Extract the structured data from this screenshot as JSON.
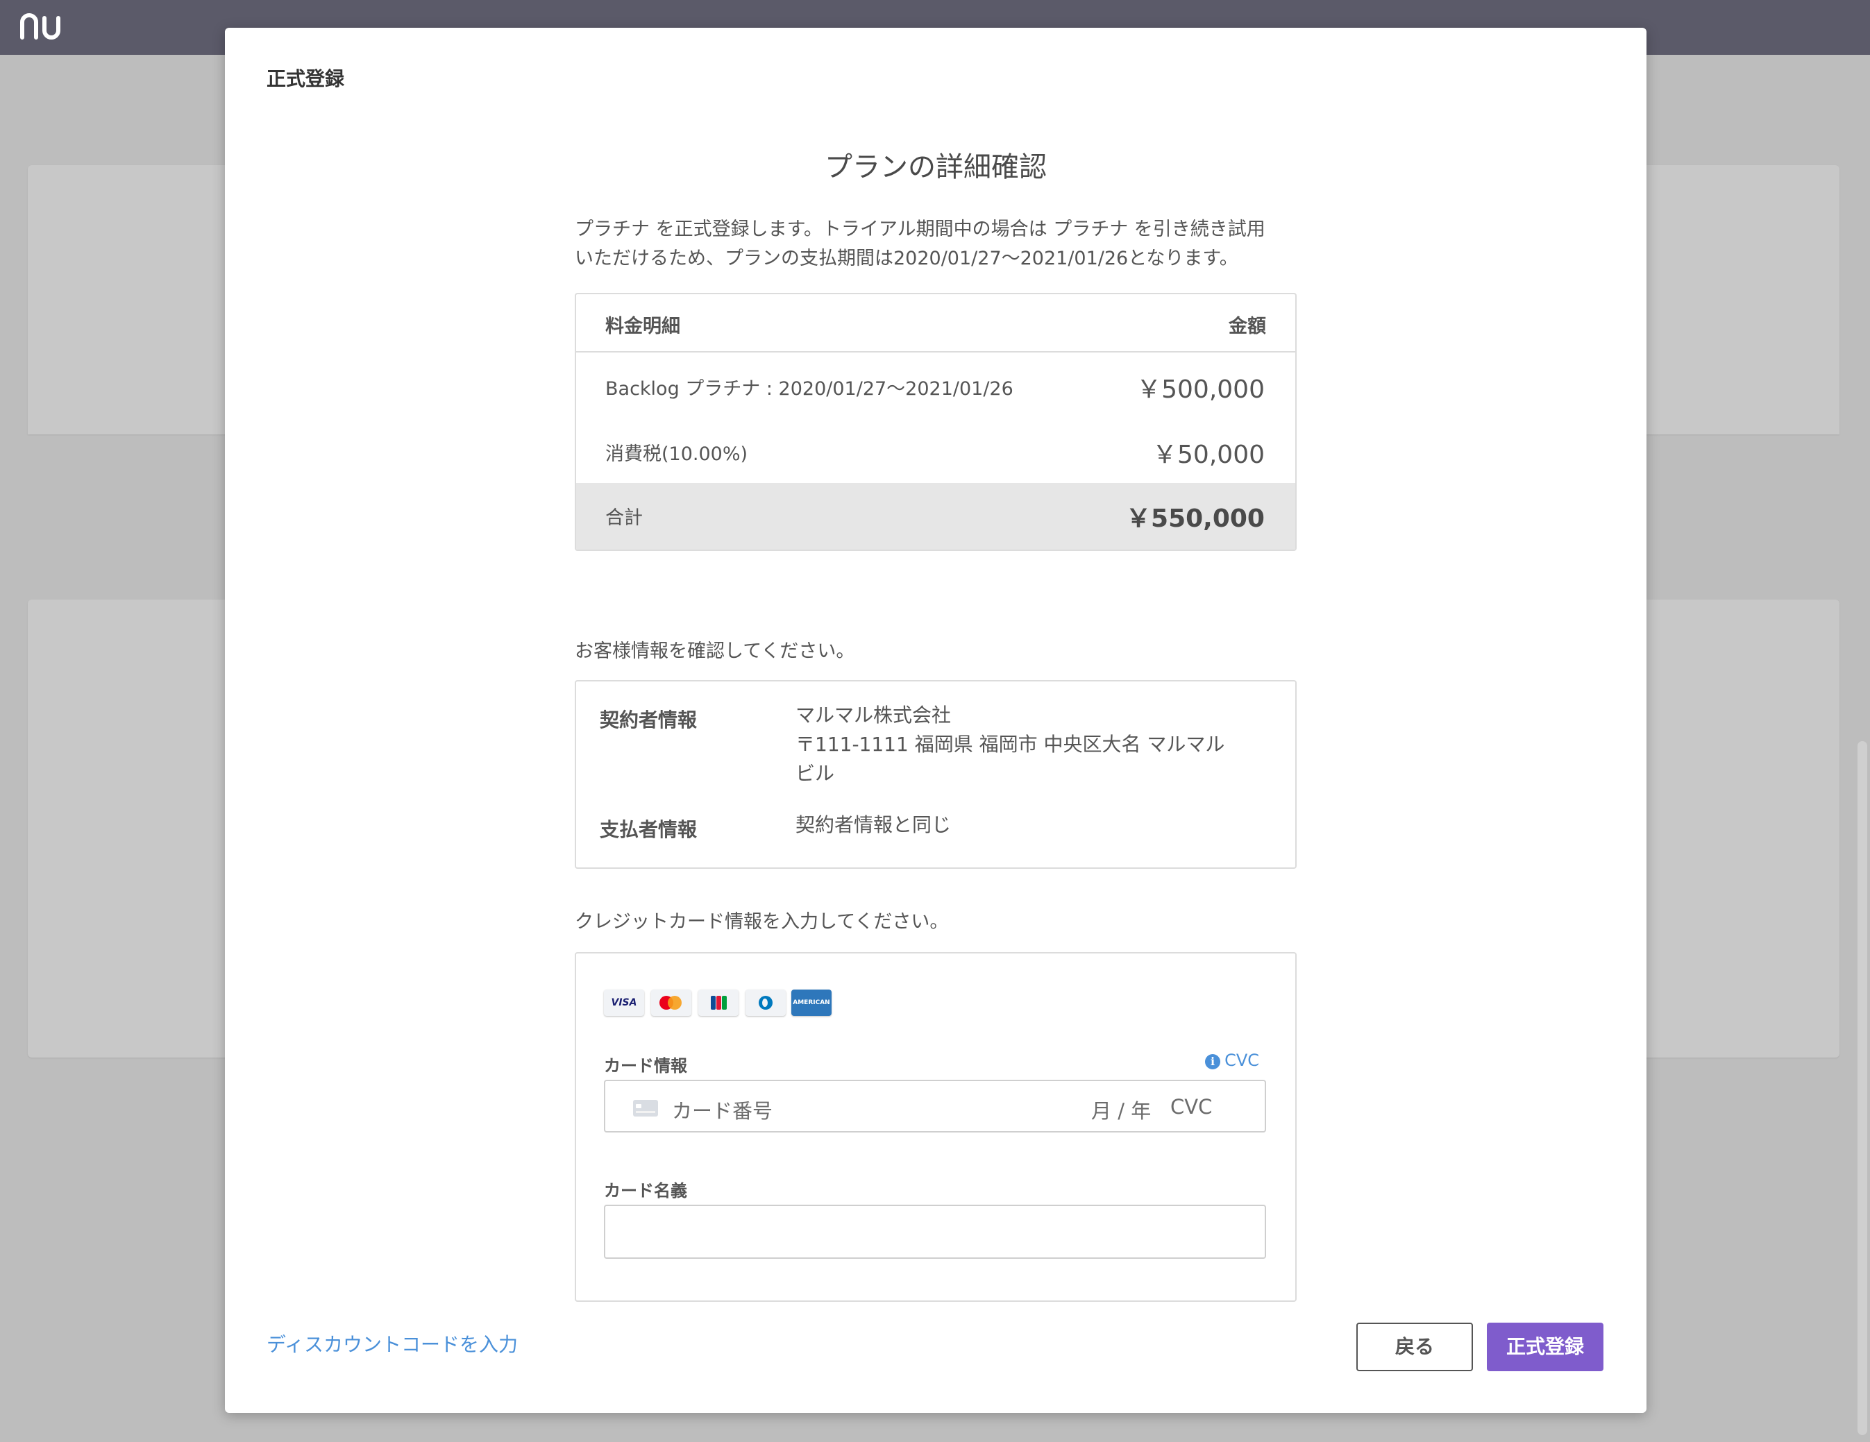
{
  "app": {
    "logo_icon": "nu-logo-icon"
  },
  "modal": {
    "header": "正式登録",
    "title": "プランの詳細確認",
    "intro_lines": [
      "プラチナ を正式登録します。トライアル期間中の場合は プラチナ を引き続き試用",
      "いただけるため、プランの支払期間は2020/01/27〜2021/01/26となります。"
    ]
  },
  "price_table": {
    "header_item": "料金明細",
    "header_amount": "金額",
    "rows": [
      {
        "label": "Backlog プラチナ : 2020/01/27〜2021/01/26",
        "amount": "￥500,000"
      },
      {
        "label": "消費税(10.00%)",
        "amount": "￥50,000"
      }
    ],
    "total": {
      "label": "合計",
      "amount": "￥550,000"
    }
  },
  "customer": {
    "prompt": "お客様情報を確認してください。",
    "contractor_label": "契約者情報",
    "contractor_lines": [
      "マルマル株式会社",
      "〒111-1111 福岡県 福岡市 中央区大名 マルマル",
      "ビル"
    ],
    "payer_label": "支払者情報",
    "payer_value": "契約者情報と同じ"
  },
  "card": {
    "prompt": "クレジットカード情報を入力してください。",
    "brands": [
      "VISA",
      "Mastercard",
      "JCB",
      "Diners",
      "American Express"
    ],
    "visa_text": "VISA",
    "amex_text": "AMERICAN EXPRESS",
    "card_info_label": "カード情報",
    "cvc_hint": "CVC",
    "number_placeholder": "カード番号",
    "expiry_placeholder": "月 / 年",
    "cvc_placeholder": "CVC",
    "name_label": "カード名義",
    "name_value": ""
  },
  "footer": {
    "discount_link": "ディスカウントコードを入力",
    "back_button": "戻る",
    "submit_button": "正式登録"
  },
  "colors": {
    "topbar": "#5b5a69",
    "accent": "#7f5ccc",
    "link": "#4a90d9",
    "total_row": "#e6e6e6"
  }
}
